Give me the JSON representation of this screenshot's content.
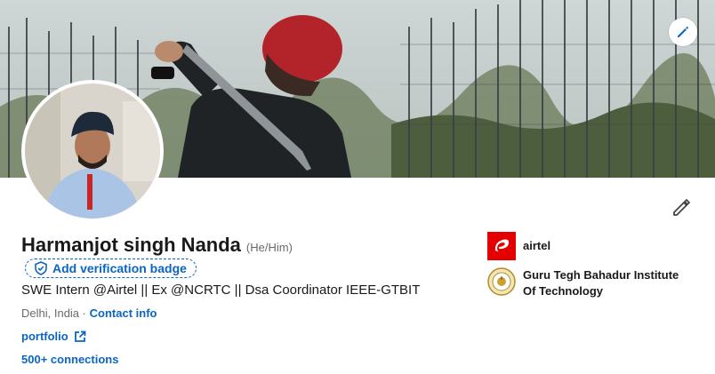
{
  "profile": {
    "name": "Harmanjot singh Nanda",
    "pronouns": "(He/Him)",
    "verification_label": "Add verification badge",
    "headline": "SWE Intern @Airtel || Ex @NCRTC || Dsa Coordinator IEEE-GTBIT",
    "location": "Delhi, India",
    "separator": "·",
    "contact_info": "Contact info",
    "portfolio": "portfolio",
    "connections": "500+ connections"
  },
  "experience": [
    {
      "label": "airtel",
      "logo": "airtel-logo"
    },
    {
      "label": "Guru Tegh Bahadur Institute Of Technology",
      "logo": "gtbit-logo"
    }
  ],
  "colors": {
    "link_blue": "#0a66c2",
    "airtel_red": "#e40000",
    "turban_red": "#b3232a"
  },
  "icons": [
    "pencil-icon",
    "shield-check-icon",
    "external-link-icon"
  ]
}
